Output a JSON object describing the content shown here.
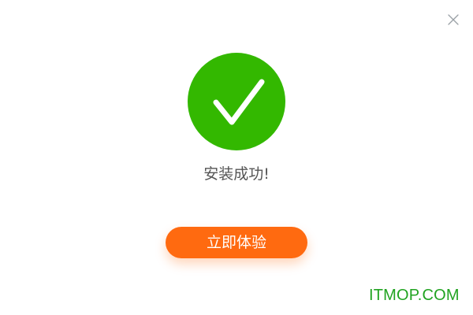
{
  "dialog": {
    "close_icon": "close-icon",
    "status_icon": "check-circle-icon",
    "status_color": "#33b800",
    "message": "安装成功!",
    "primary_button_label": "立即体验",
    "primary_button_color": "#ff6a10"
  },
  "watermark": {
    "text": "ITMOP.COM",
    "color": "#21a321"
  }
}
